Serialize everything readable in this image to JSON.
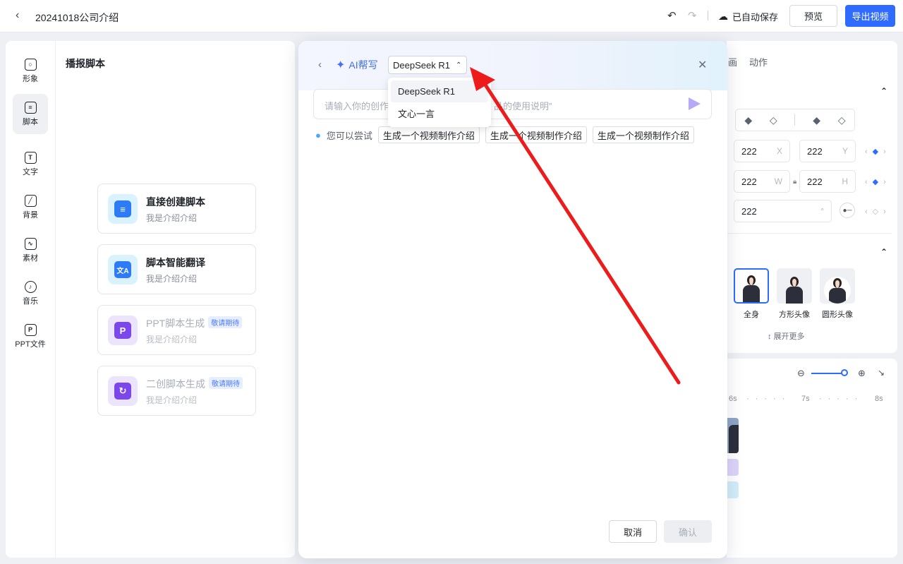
{
  "topbar": {
    "title": "20241018公司介绍",
    "save_status": "已自动保存",
    "preview_label": "预览",
    "export_label": "导出视频"
  },
  "sidenav": [
    {
      "label": "形象",
      "icon": "avatar-icon"
    },
    {
      "label": "脚本",
      "icon": "script-icon"
    },
    {
      "label": "文字",
      "icon": "text-icon"
    },
    {
      "label": "背景",
      "icon": "background-icon"
    },
    {
      "label": "素材",
      "icon": "material-icon"
    },
    {
      "label": "音乐",
      "icon": "music-icon"
    },
    {
      "label": "PPT文件",
      "icon": "ppt-icon"
    }
  ],
  "left_panel": {
    "title": "播报脚本",
    "cards": [
      {
        "title": "直接创建脚本",
        "sub": "我是介绍介绍",
        "badge": ""
      },
      {
        "title": "脚本智能翻译",
        "sub": "我是介绍介绍",
        "badge": ""
      },
      {
        "title": "PPT脚本生成",
        "sub": "我是介绍介绍",
        "badge": "敬请期待"
      },
      {
        "title": "二创脚本生成",
        "sub": "我是介绍介绍",
        "badge": "敬请期待"
      }
    ]
  },
  "modal": {
    "title": "AI帮写",
    "selected_model": "DeepSeek R1",
    "model_options": [
      "DeepSeek R1",
      "文心一言"
    ],
    "prompt_placeholder_left": "请输入你的创作主",
    "prompt_placeholder_right": "品的使用说明”",
    "suggest_label": "您可以尝试",
    "suggestions": [
      "生成一个视频制作介绍",
      "生成一个视频制作介绍",
      "生成一个视频制作介绍"
    ],
    "cancel_label": "取消",
    "confirm_label": "确认"
  },
  "right_panel": {
    "tab_partial": "画",
    "tab_action": "动作",
    "x": {
      "value": "222",
      "unit": "X"
    },
    "y": {
      "value": "222",
      "unit": "Y"
    },
    "w": {
      "value": "222",
      "unit": "W"
    },
    "h": {
      "value": "222",
      "unit": "H"
    },
    "rotation": {
      "value": "222",
      "unit": "°"
    },
    "avatar_options": [
      "全身",
      "方形头像",
      "圆形头像"
    ],
    "expand_more": "展开更多"
  },
  "timeline": {
    "ticks": [
      "6s",
      "7s",
      "8s"
    ]
  },
  "colors": {
    "accent": "#2f6bff",
    "arrow": "#ee1b1b"
  }
}
